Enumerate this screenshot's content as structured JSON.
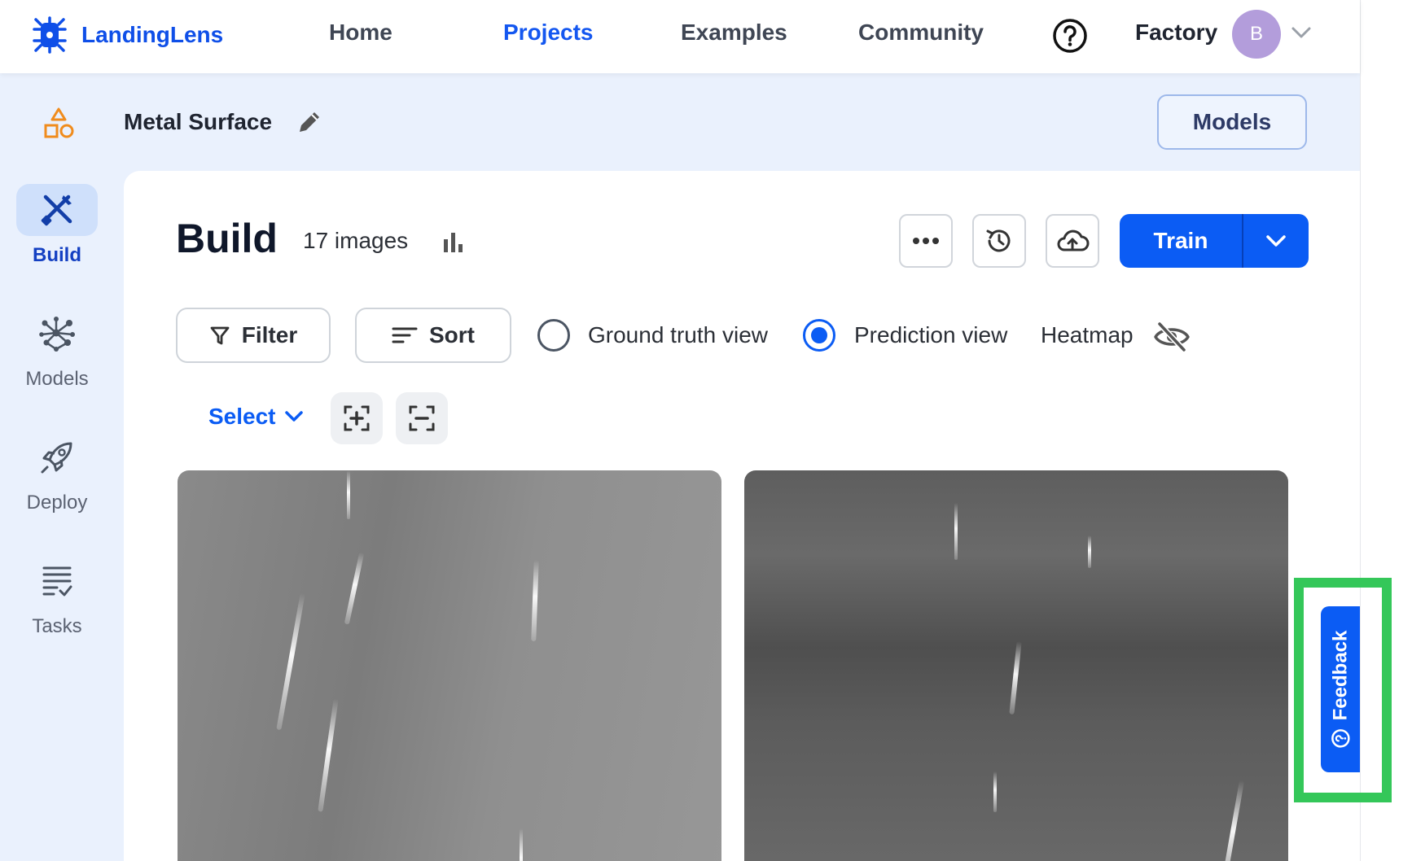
{
  "app": {
    "name": "LandingLens"
  },
  "nav": {
    "links": [
      "Home",
      "Projects",
      "Examples",
      "Community"
    ],
    "active": "Projects",
    "org": "Factory",
    "avatar_initial": "B"
  },
  "project": {
    "title": "Metal Surface",
    "models_button": "Models"
  },
  "sidebar": {
    "items": [
      {
        "label": "Build",
        "icon": "tools-icon",
        "active": true
      },
      {
        "label": "Models",
        "icon": "network-icon",
        "active": false
      },
      {
        "label": "Deploy",
        "icon": "rocket-icon",
        "active": false
      },
      {
        "label": "Tasks",
        "icon": "checklist-icon",
        "active": false
      }
    ]
  },
  "build": {
    "title": "Build",
    "image_count": "17 images",
    "train_label": "Train",
    "filter_label": "Filter",
    "sort_label": "Sort",
    "ground_truth_label": "Ground truth view",
    "prediction_label": "Prediction view",
    "selected_view": "prediction",
    "heatmap_label": "Heatmap",
    "select_label": "Select"
  },
  "feedback": {
    "label": "Feedback"
  },
  "colors": {
    "primary": "#0b5cf4",
    "highlight": "#34c759",
    "backdrop": "#eaf1fd"
  }
}
